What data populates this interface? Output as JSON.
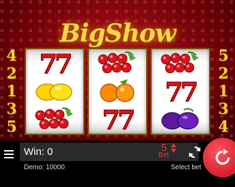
{
  "game": {
    "logo_text": "BigShow",
    "left_paylines": [
      "4",
      "2",
      "1",
      "3",
      "5"
    ],
    "right_paylines": [
      "5",
      "2",
      "1",
      "3",
      "4"
    ],
    "reels": [
      [
        "seven",
        "lemon",
        "cherries"
      ],
      [
        "cherries",
        "orange",
        "seven"
      ],
      [
        "cherries",
        "seven",
        "plum"
      ]
    ]
  },
  "bar": {
    "win_label": "Win:",
    "win_value": "0",
    "bet_value": "5",
    "bet_label": "Bet",
    "demo_label": "Demo:",
    "demo_value": "10000",
    "select_bet": "Select bet"
  },
  "colors": {
    "accent_red": "#e8323c",
    "gold": "#ffcd3a"
  }
}
